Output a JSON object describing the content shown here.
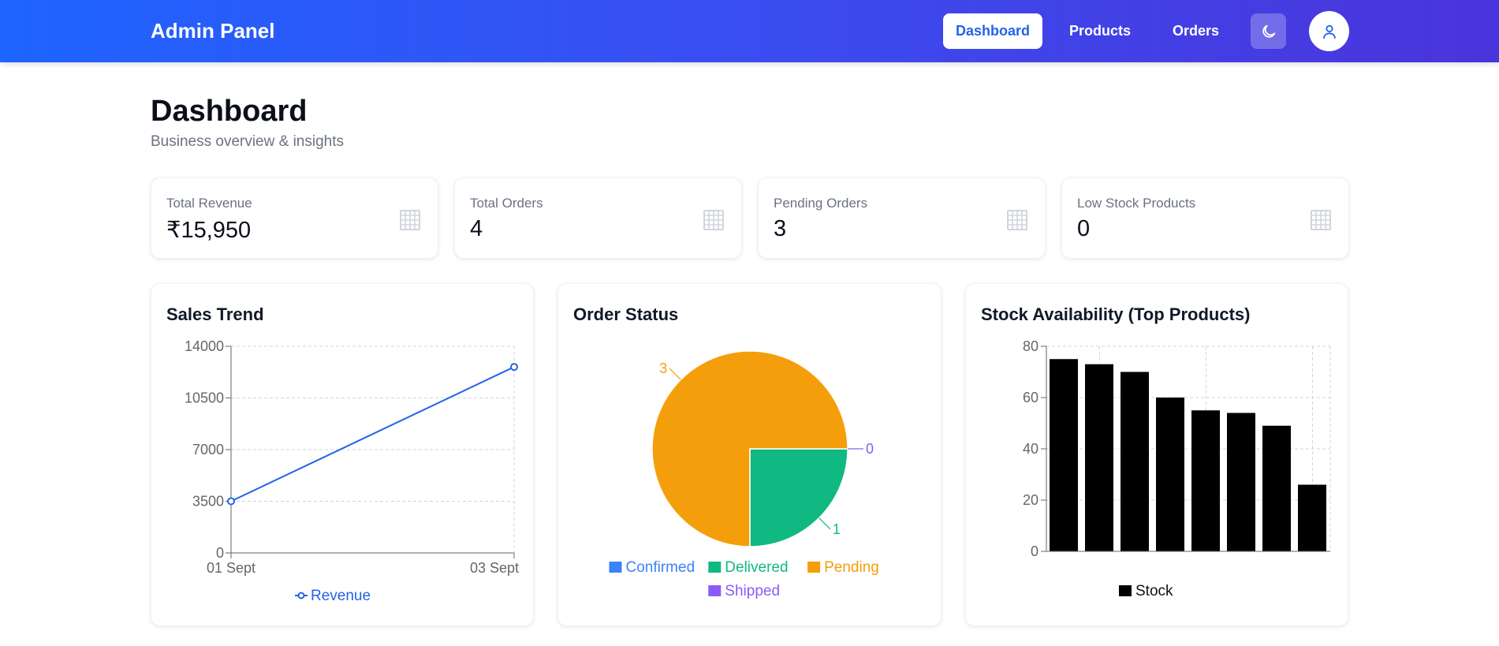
{
  "header": {
    "brand": "Admin Panel",
    "nav": [
      {
        "label": "Dashboard",
        "active": true
      },
      {
        "label": "Products",
        "active": false
      },
      {
        "label": "Orders",
        "active": false
      }
    ],
    "theme_icon": "moon-icon",
    "avatar_icon": "user-icon",
    "gradient": [
      "#1e64ff",
      "#4a34db"
    ]
  },
  "page": {
    "title": "Dashboard",
    "subtitle": "Business overview & insights"
  },
  "stats": [
    {
      "label": "Total Revenue",
      "value": "₹15,950",
      "icon": "grid-icon"
    },
    {
      "label": "Total Orders",
      "value": "4",
      "icon": "grid-icon"
    },
    {
      "label": "Pending Orders",
      "value": "3",
      "icon": "grid-icon"
    },
    {
      "label": "Low Stock Products",
      "value": "0",
      "icon": "grid-icon"
    }
  ],
  "chart_data": [
    {
      "type": "line",
      "title": "Sales Trend",
      "x": [
        "01 Sept",
        "03 Sept"
      ],
      "series": [
        {
          "name": "Revenue",
          "values": [
            3500,
            12600
          ],
          "color": "#2563eb"
        }
      ],
      "yticks": [
        "0",
        "3500",
        "7000",
        "10500",
        "14000"
      ],
      "ylim": [
        0,
        14000
      ],
      "grid": true,
      "legend": "bottom"
    },
    {
      "type": "pie",
      "title": "Order Status",
      "slices": [
        {
          "name": "Confirmed",
          "value": 0,
          "label": "",
          "color": "#3b82f6"
        },
        {
          "name": "Delivered",
          "value": 1,
          "label": "1",
          "color": "#10b981"
        },
        {
          "name": "Pending",
          "value": 3,
          "label": "3",
          "color": "#f59e0b"
        },
        {
          "name": "Shipped",
          "value": 0,
          "label": "0",
          "color": "#8b5cf6"
        }
      ],
      "legend": "bottom"
    },
    {
      "type": "bar",
      "title": "Stock Availability (Top Products)",
      "categories": [
        "",
        "",
        "",
        "",
        "",
        "",
        "",
        ""
      ],
      "series": [
        {
          "name": "Stock",
          "values": [
            75,
            73,
            70,
            60,
            55,
            54,
            49,
            26
          ],
          "color": "#000000"
        }
      ],
      "yticks": [
        "0",
        "20",
        "40",
        "60",
        "80"
      ],
      "ylim": [
        0,
        80
      ],
      "grid": true,
      "legend": "bottom"
    }
  ]
}
